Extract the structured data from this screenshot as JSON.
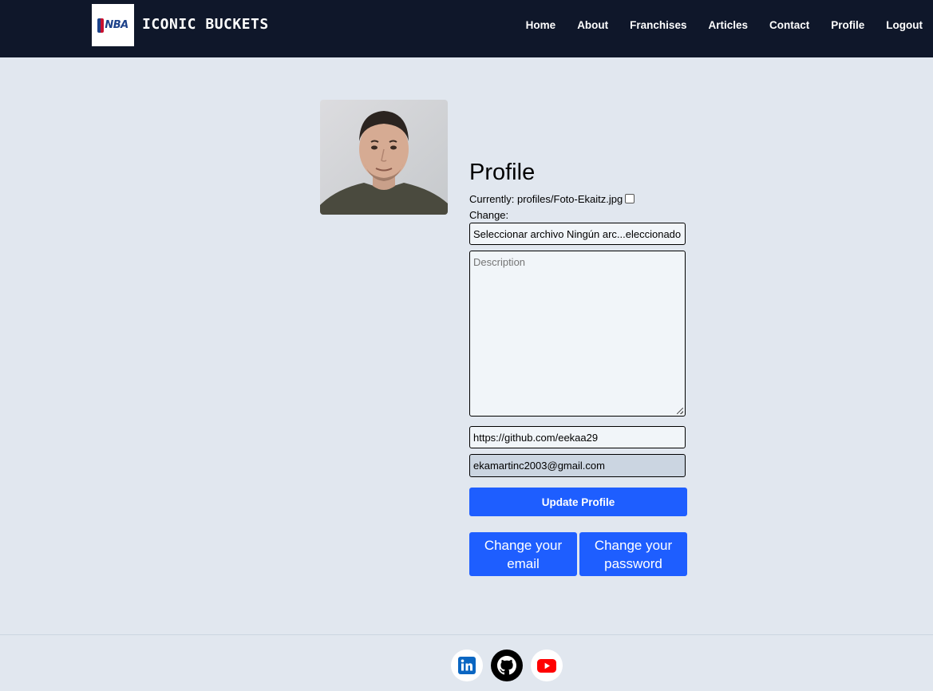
{
  "navbar": {
    "logo_text": "NBA",
    "brand": "ICONIC BUCKETS",
    "links": [
      "Home",
      "About",
      "Franchises",
      "Articles",
      "Contact",
      "Profile",
      "Logout"
    ]
  },
  "profile": {
    "title": "Profile",
    "currently_label": "Currently:",
    "current_file": "profiles/Foto-Ekaitz.jpg",
    "change_label": "Change:",
    "file_input_text": "Seleccionar archivo Ningún arc...eleccionado",
    "description_placeholder": "Description",
    "url_value": "https://github.com/eekaa29",
    "email_value": "ekamartinc2003@gmail.com",
    "update_button": "Update Profile",
    "change_email_button": "Change your email",
    "change_password_button": "Change your password"
  },
  "footer": {
    "icons": [
      "linkedin-icon",
      "github-icon",
      "youtube-icon"
    ]
  },
  "colors": {
    "navbar_bg": "#0f172a",
    "page_bg": "#e1e7ef",
    "button_blue": "#1e5eff",
    "linkedin": "#0a66c2",
    "youtube": "#ff0000"
  }
}
